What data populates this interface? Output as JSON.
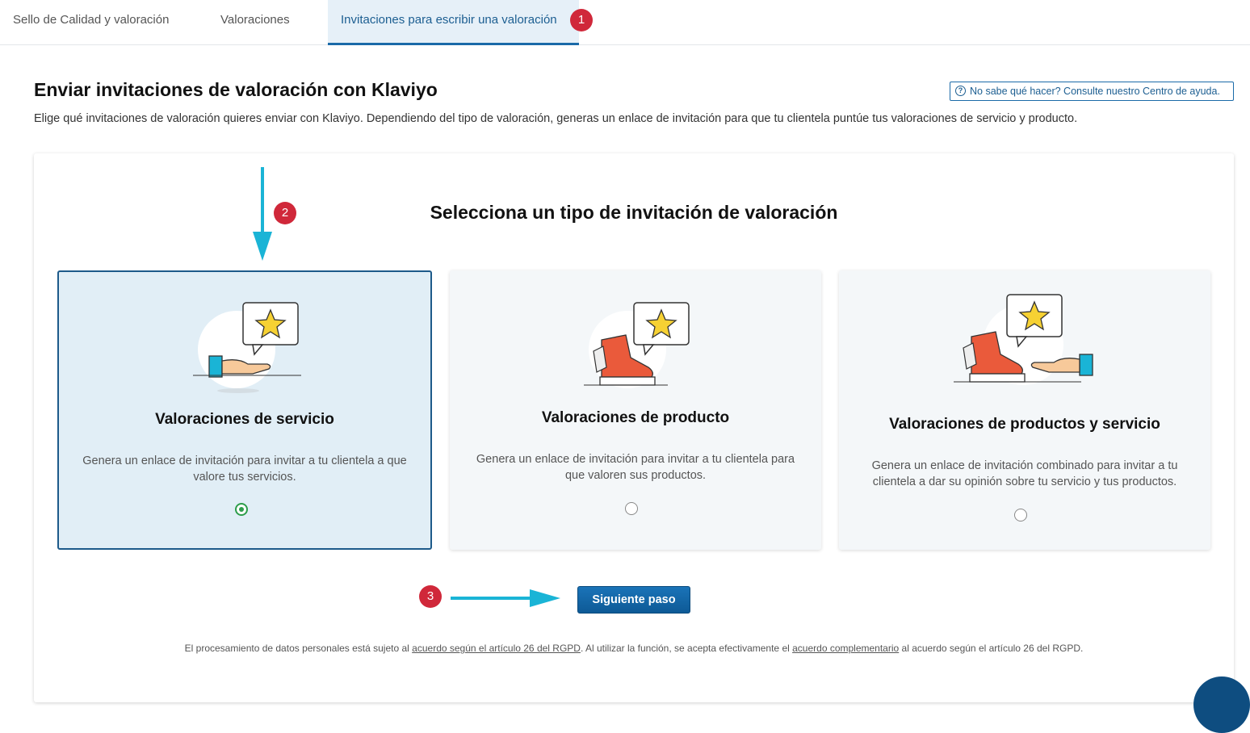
{
  "tabs": [
    {
      "label": "Sello de Calidad y valoración",
      "active": false
    },
    {
      "label": "Valoraciones",
      "active": false
    },
    {
      "label": "Invitaciones para escribir una valoración",
      "active": true
    }
  ],
  "badges": [
    "1",
    "2",
    "3"
  ],
  "page": {
    "title": "Enviar invitaciones de valoración con Klaviyo",
    "subtitle": "Elige qué invitaciones de valoración quieres enviar con Klaviyo. Dependiendo del tipo de valoración, generas un enlace de invitación para que tu clientela puntúe tus valoraciones de servicio y producto.",
    "help_link": "No sabe qué hacer? Consulte nuestro Centro de ayuda."
  },
  "section": {
    "title": "Selecciona un tipo de invitación de valoración"
  },
  "cards": [
    {
      "title": "Valoraciones de servicio",
      "description": "Genera un enlace de invitación para invitar a tu clientela a que valore tus servicios.",
      "selected": true
    },
    {
      "title": "Valoraciones de producto",
      "description": "Genera un enlace de invitación para invitar a tu clientela para que valoren sus productos.",
      "selected": false
    },
    {
      "title": "Valoraciones de productos y servicio",
      "description": "Genera un enlace de invitación combinado para invitar a tu clientela a dar su opinión sobre tu servicio y tus productos.",
      "selected": false
    }
  ],
  "next_button": "Siguiente paso",
  "legal": {
    "part1": "El procesamiento de datos personales está sujeto al ",
    "link1": "acuerdo según el artículo 26 del RGPD",
    "part2": ". Al utilizar la función, se acepta efectivamente el ",
    "link2": "acuerdo complementario",
    "part3": " al acuerdo según el artículo 26 del RGPD."
  },
  "colors": {
    "accent": "#1a6aa8",
    "badge": "#d0283a",
    "annotation_arrow": "#1ab4d6",
    "radio_selected": "#2d9d4b"
  }
}
